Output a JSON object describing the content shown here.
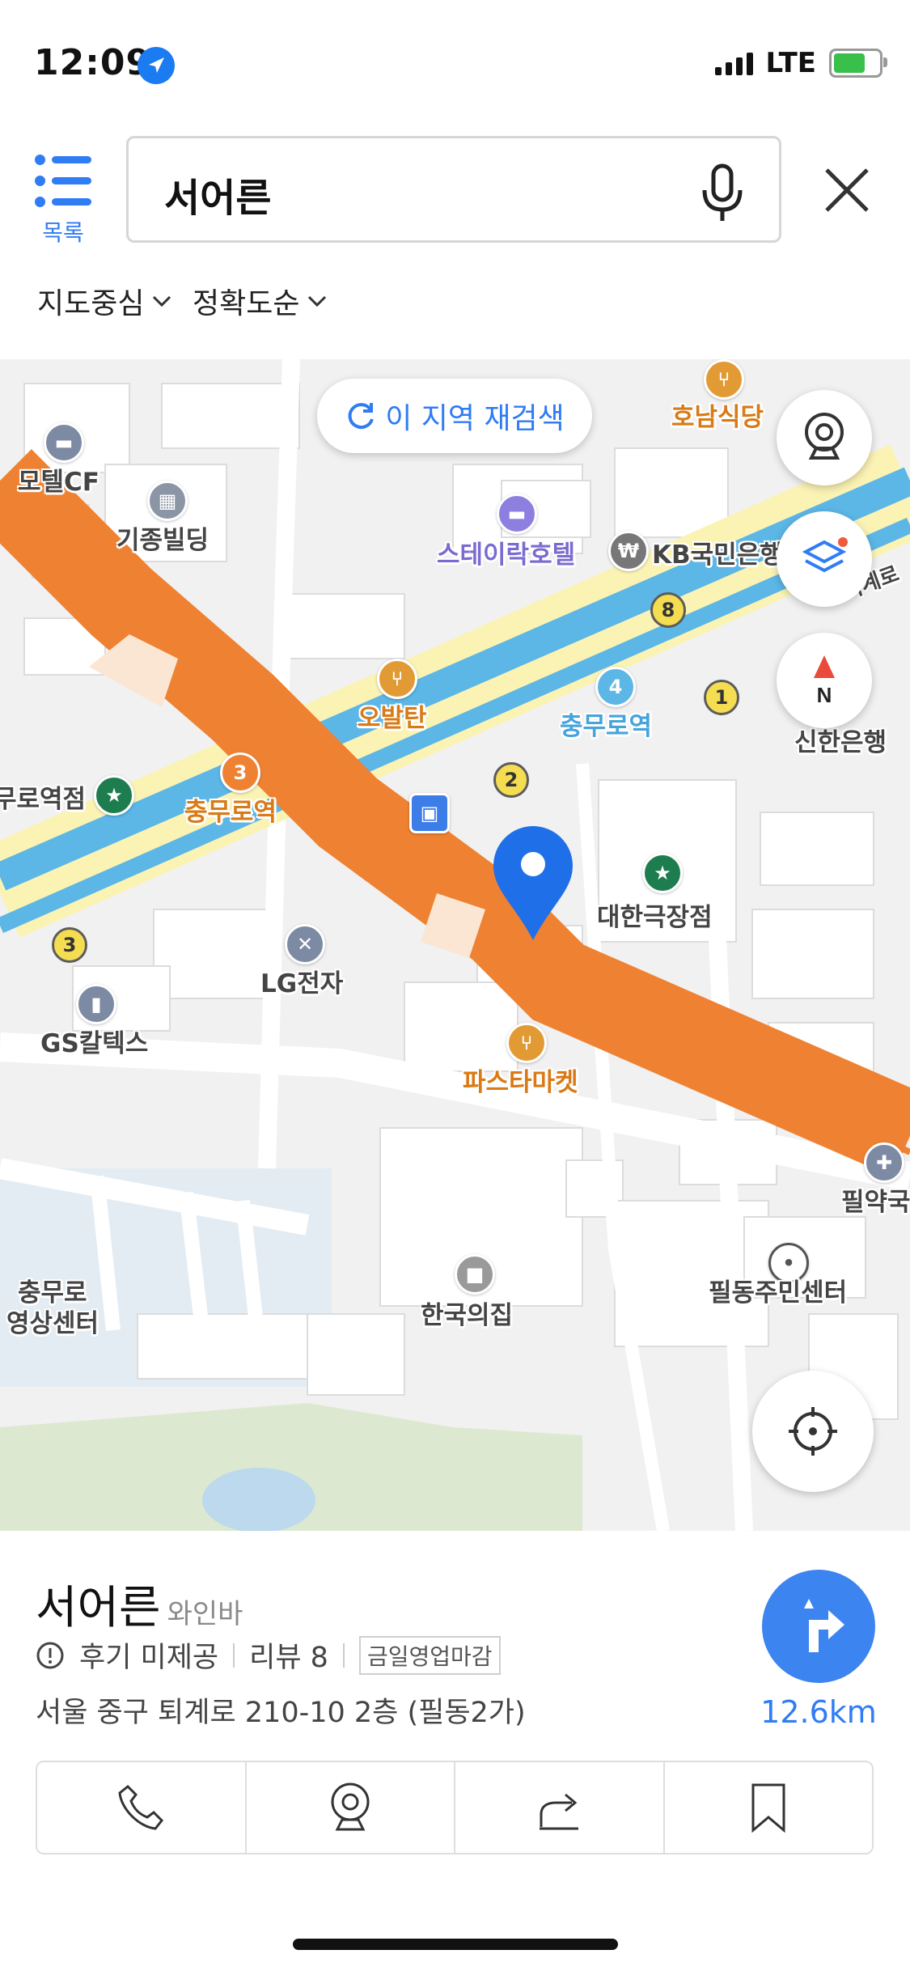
{
  "status_bar": {
    "time": "12:09",
    "network": "LTE"
  },
  "header": {
    "list_label": "목록",
    "search_value": "서어른",
    "filters": [
      "지도중심",
      "정확도순"
    ]
  },
  "map": {
    "research_label": "이 지역 재검색",
    "labels": {
      "motel_cf": "모텔CF",
      "gijong_building": "기종빌딩",
      "stay_lark_hotel": "스테이락호텔",
      "kb_bank": "KB국민은행",
      "honam_restaurant": "호남식당",
      "obaltan": "오발탄",
      "chungmuro_station_blue": "충무로역",
      "chungmuro_station_orange": "충무로역",
      "starbucks_left": "무로역점",
      "shinhan_bank": "신한은행",
      "daehan_theater": "대한극장점",
      "lg_electronics": "LG전자",
      "gs_caltex": "GS칼텍스",
      "pasta_market": "파스타마켓",
      "pharmacy": "필약국",
      "toegyero": "퇴계로",
      "chungmuro_video_center_1": "충무로",
      "chungmuro_video_center_2": "영상센터",
      "korea_house": "한국의집",
      "pildong_center": "필동주민센터"
    },
    "exits": {
      "e8": "8",
      "e1": "1",
      "e2": "2",
      "e3": "3",
      "line4": "4",
      "line3": "3"
    },
    "colors": {
      "line3": "#ef8232",
      "line4": "#5cb6e6",
      "road_yellow": "#fbf3b4",
      "park": "#dce9d0",
      "pin": "#1f6fe8"
    }
  },
  "place": {
    "name": "서어른",
    "category": "와인바",
    "review_status": "후기 미제공",
    "review_label": "리뷰 8",
    "closed_badge": "금일영업마감",
    "address": "서울 중구 퇴계로 210-10 2층 (필동2가)",
    "distance": "12.6km"
  },
  "actions": [
    "phone-icon",
    "streetview-icon",
    "share-icon",
    "bookmark-icon"
  ]
}
